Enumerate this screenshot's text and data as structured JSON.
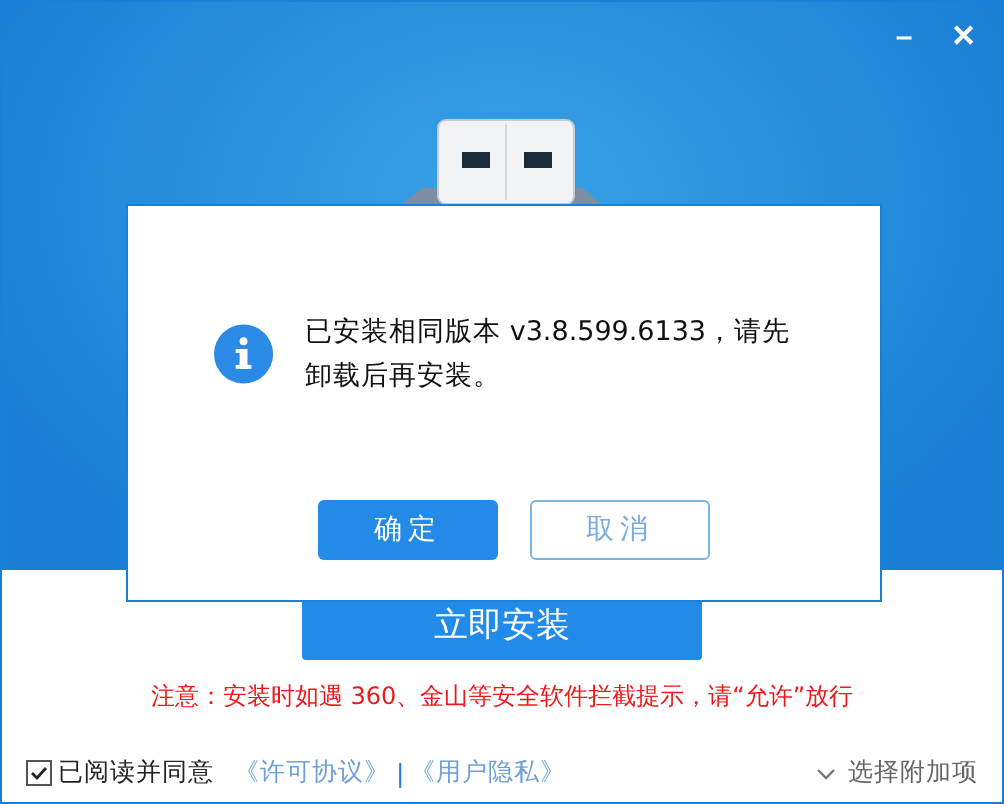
{
  "window": {
    "minimize": "–",
    "close": "✕"
  },
  "dialog": {
    "message": "已安装相同版本 v3.8.599.6133，请先卸载后再安装。",
    "buttons": [
      {
        "label": "确定",
        "kind": "primary"
      },
      {
        "label": "取消",
        "kind": "secondary"
      }
    ]
  },
  "install_button": "立即安装",
  "notice": "注意：安装时如遇 360、金山等安全软件拦截提示，请“允许”放行",
  "footer": {
    "agree": {
      "label": "已阅读并同意",
      "checked": true
    },
    "links": [
      "《许可协议》",
      "《用户隐私》"
    ],
    "separator": "|",
    "options": "选择附加项"
  }
}
